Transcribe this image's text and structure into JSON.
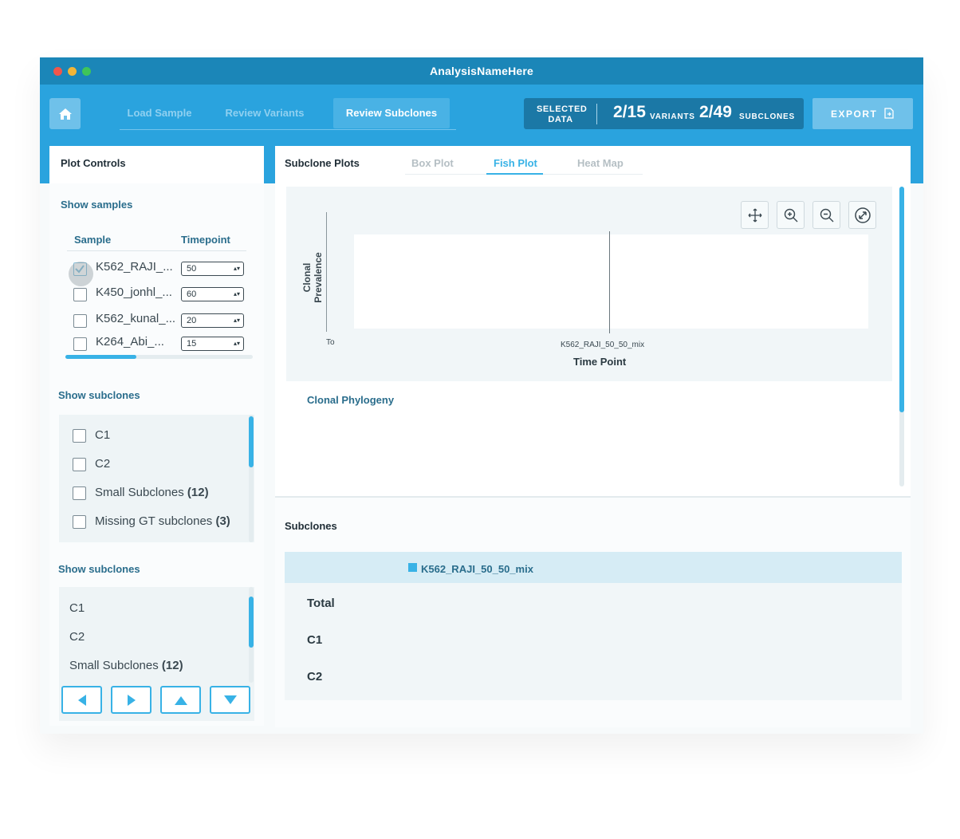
{
  "window": {
    "title": "AnalysisNameHere"
  },
  "nav": {
    "tabs": [
      {
        "label": "Load Sample"
      },
      {
        "label": "Review Variants"
      },
      {
        "label": "Review Subclones"
      }
    ],
    "active_tab": "Review Subclones"
  },
  "selected_data": {
    "label_line1": "SELECTED",
    "label_line2": "DATA",
    "variants_value": "2/15",
    "variants_unit": "VARIANTS",
    "subclones_value": "2/49",
    "subclones_unit": "SUBCLONES"
  },
  "export": {
    "label": "EXPORT"
  },
  "plot_controls": {
    "title": "Plot Controls",
    "show_samples_label": "Show samples",
    "columns": {
      "sample": "Sample",
      "timepoint": "Timepoint"
    },
    "samples": [
      {
        "name": "K562_RAJI_...",
        "timepoint": "50",
        "checked": true
      },
      {
        "name": "K450_jonhl_...",
        "timepoint": "60",
        "checked": false
      },
      {
        "name": "K562_kunal_...",
        "timepoint": "20",
        "checked": false
      },
      {
        "name": "K264_Abi_...",
        "timepoint": "15",
        "checked": false
      }
    ],
    "samples_scroll_fraction": 0.38,
    "show_subclones_label": "Show subclones",
    "subclone_checks": [
      {
        "name": "C1",
        "count": ""
      },
      {
        "name": "C2",
        "count": ""
      },
      {
        "name": "Small Subclones",
        "count": "(12)"
      },
      {
        "name": "Missing GT subclones",
        "count": "(3)"
      }
    ],
    "show_subclones_label_2": "Show subclones",
    "subclone_list": [
      {
        "name": "C1",
        "count": ""
      },
      {
        "name": "C2",
        "count": ""
      },
      {
        "name": "Small Subclones",
        "count": "(12)"
      }
    ],
    "arrow_buttons": [
      "arrow-left-icon",
      "arrow-right-icon",
      "arrow-up-icon",
      "arrow-down-icon"
    ]
  },
  "subclone_plots": {
    "title": "Subclone Plots",
    "tabs": [
      "Box Plot",
      "Fish Plot",
      "Heat Map"
    ],
    "active_tab": "Fish Plot",
    "tools": [
      "pan-icon",
      "zoom-in-icon",
      "zoom-out-icon",
      "reset-view-icon"
    ],
    "plot": {
      "y_label": "Clonal Prevalence",
      "x_label": "Time Point",
      "x_start_tick": "To",
      "x_tick": "K562_RAJI_50_50_mix"
    },
    "clonal_phylogeny_label": "Clonal Phylogeny"
  },
  "subclones_table": {
    "title": "Subclones",
    "column": "K562_RAJI_50_50_mix",
    "rows": [
      "Total",
      "C1",
      "C2"
    ]
  },
  "colors": {
    "accent": "#38b2e6",
    "titlebar": "#1b86b8",
    "topbar": "#2aa3de"
  }
}
